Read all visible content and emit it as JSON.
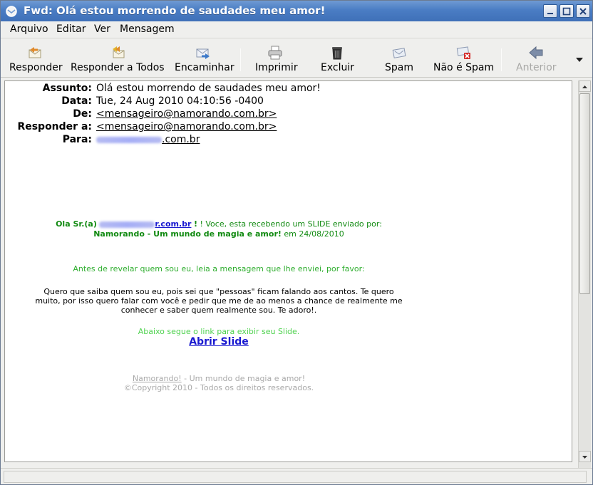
{
  "window": {
    "title": "Fwd: Olá estou morrendo de saudades meu amor!",
    "minimize_icon": "minimize-icon",
    "maximize_icon": "maximize-icon",
    "close_icon": "close-icon",
    "titlebar_color": "#4a7dc4"
  },
  "menu": {
    "items": [
      "Arquivo",
      "Editar",
      "Ver",
      "Mensagem"
    ]
  },
  "toolbar": {
    "reply": "Responder",
    "reply_all": "Responder a Todos",
    "forward": "Encaminhar",
    "print": "Imprimir",
    "delete": "Excluir",
    "spam": "Spam",
    "not_spam": "Não é Spam",
    "previous": "Anterior"
  },
  "headers": {
    "subject_label": "Assunto:",
    "subject": "Olá estou morrendo de saudades meu amor!",
    "date_label": "Data:",
    "date": "Tue, 24 Aug 2010 04:10:56 -0400",
    "from_label": "De:",
    "from": "<mensageiro@namorando.com.br>",
    "reply_to_label": "Responder a:",
    "reply_to": "<mensageiro@namorando.com.br>",
    "to_label": "Para:",
    "to_visible": ".com.br"
  },
  "body": {
    "greeting_prefix": "Ola Sr.(a)",
    "greeting_domain": "r.com.br",
    "greeting_suffix": "! Voce, esta recebendo um SLIDE enviado por:",
    "sender_name": "Namorando - Um mundo de magia e amor!",
    "sender_date": "em 24/08/2010",
    "intro": "Antes de revelar quem sou eu, leia a mensagem que lhe enviei, por favor:",
    "message_line1": "Quero que saiba quem sou eu, pois sei que \"pessoas\" ficam falando aos cantos. Te quero",
    "message_line2": "muito, por isso quero falar com você e pedir que me de ao menos a chance de realmente me",
    "message_line3": "conhecer e saber quem realmente sou. Te adoro!.",
    "link_hint": "Abaixo segue o link para exibir seu Slide.",
    "link_label": "Abrir Slide",
    "footer_brand": "Namorando!",
    "footer_tagline": " - Um mundo de magia e amor!",
    "copyright": "©Copyright 2010 - Todos os direitos reservados."
  },
  "colors": {
    "link": "#1a1ad0",
    "green": "#118a11",
    "light_green": "#4fd24f",
    "grey": "#a9a9a9"
  }
}
